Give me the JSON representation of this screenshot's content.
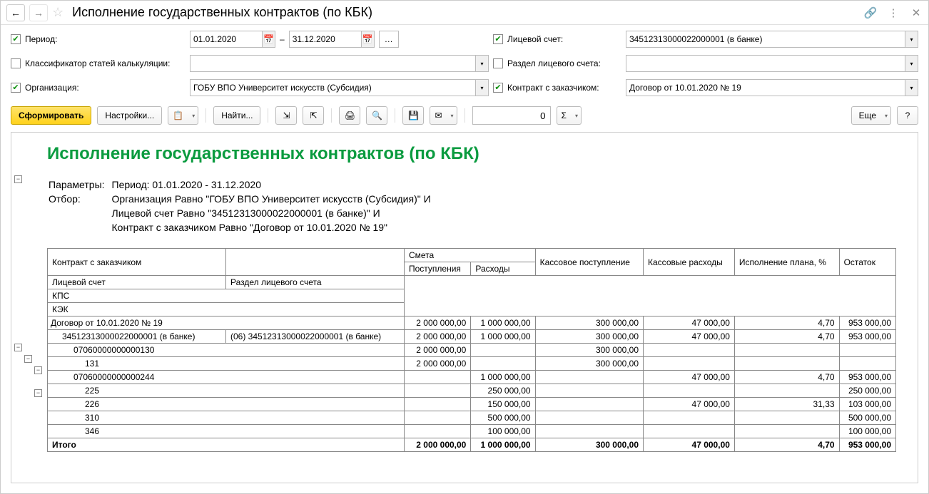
{
  "title": "Исполнение государственных контрактов (по КБК)",
  "filters": {
    "period_label": "Период:",
    "period_from": "01.01.2020",
    "period_to": "31.12.2020",
    "dash": "–",
    "account_label": "Лицевой счет:",
    "account_value": "34512313000022000001 (в банке)",
    "classifier_label": "Классификатор статей калькуляции:",
    "classifier_value": "",
    "section_label": "Раздел лицевого счета:",
    "section_value": "",
    "org_label": "Организация:",
    "org_value": "ГОБУ ВПО Университет искусств (Субсидия)",
    "contract_label": "Контракт с заказчиком:",
    "contract_value": "Договор от 10.01.2020 № 19"
  },
  "toolbar": {
    "generate": "Сформировать",
    "settings": "Настройки...",
    "find": "Найти...",
    "zero": "0",
    "more": "Еще",
    "help": "?"
  },
  "report": {
    "title": "Исполнение государственных контрактов (по КБК)",
    "params_label": "Параметры:",
    "params_text": "Период: 01.01.2020 - 31.12.2020",
    "filter_label": "Отбор:",
    "filter_line1": "Организация Равно \"ГОБУ ВПО Университет искусств (Субсидия)\" И",
    "filter_line2": "Лицевой счет Равно \"34512313000022000001 (в банке)\" И",
    "filter_line3": "Контракт с заказчиком Равно \"Договор от 10.01.2020 № 19\"",
    "headers": {
      "contract": "Контракт с заказчиком",
      "account": "Лицевой счет",
      "section": "Раздел лицевого счета",
      "kps": "КПС",
      "kek": "КЭК",
      "estimate": "Смета",
      "receipts": "Поступления",
      "expenses": "Расходы",
      "cash_in": "Кассовое поступление",
      "cash_out": "Кассовые расходы",
      "plan_pct": "Исполнение плана, %",
      "balance": "Остаток"
    },
    "rows": [
      {
        "c0": "Договор от 10.01.2020 № 19",
        "c1": "",
        "r": "2 000 000,00",
        "e": "1 000 000,00",
        "ci": "300 000,00",
        "co": "47 000,00",
        "p": "4,70",
        "b": "953 000,00",
        "indent": 0
      },
      {
        "c0": "34512313000022000001 (в банке)",
        "c1": "(06) 34512313000022000001 (в банке)",
        "r": "2 000 000,00",
        "e": "1 000 000,00",
        "ci": "300 000,00",
        "co": "47 000,00",
        "p": "4,70",
        "b": "953 000,00",
        "indent": 1
      },
      {
        "c0": "07060000000000130",
        "c1": "",
        "r": "2 000 000,00",
        "e": "",
        "ci": "300 000,00",
        "co": "",
        "p": "",
        "b": "",
        "indent": 2
      },
      {
        "c0": "131",
        "c1": "",
        "r": "2 000 000,00",
        "e": "",
        "ci": "300 000,00",
        "co": "",
        "p": "",
        "b": "",
        "indent": 3
      },
      {
        "c0": "07060000000000244",
        "c1": "",
        "r": "",
        "e": "1 000 000,00",
        "ci": "",
        "co": "47 000,00",
        "p": "4,70",
        "b": "953 000,00",
        "indent": 2
      },
      {
        "c0": "225",
        "c1": "",
        "r": "",
        "e": "250 000,00",
        "ci": "",
        "co": "",
        "p": "",
        "b": "250 000,00",
        "indent": 3
      },
      {
        "c0": "226",
        "c1": "",
        "r": "",
        "e": "150 000,00",
        "ci": "",
        "co": "47 000,00",
        "p": "31,33",
        "b": "103 000,00",
        "indent": 3
      },
      {
        "c0": "310",
        "c1": "",
        "r": "",
        "e": "500 000,00",
        "ci": "",
        "co": "",
        "p": "",
        "b": "500 000,00",
        "indent": 3
      },
      {
        "c0": "346",
        "c1": "",
        "r": "",
        "e": "100 000,00",
        "ci": "",
        "co": "",
        "p": "",
        "b": "100 000,00",
        "indent": 3
      }
    ],
    "total": {
      "label": "Итого",
      "r": "2 000 000,00",
      "e": "1 000 000,00",
      "ci": "300 000,00",
      "co": "47 000,00",
      "p": "4,70",
      "b": "953 000,00"
    }
  },
  "chart_data": {
    "type": "table",
    "title": "Исполнение государственных контрактов (по КБК)",
    "columns": [
      "Контракт с заказчиком",
      "Лицевой счет / Раздел",
      "Поступления",
      "Расходы",
      "Кассовое поступление",
      "Кассовые расходы",
      "Исполнение плана, %",
      "Остаток"
    ],
    "rows": [
      [
        "Договор от 10.01.2020 № 19",
        "",
        2000000.0,
        1000000.0,
        300000.0,
        47000.0,
        4.7,
        953000.0
      ],
      [
        "34512313000022000001 (в банке)",
        "(06) 34512313000022000001 (в банке)",
        2000000.0,
        1000000.0,
        300000.0,
        47000.0,
        4.7,
        953000.0
      ],
      [
        "07060000000000130",
        "",
        2000000.0,
        null,
        300000.0,
        null,
        null,
        null
      ],
      [
        "131",
        "",
        2000000.0,
        null,
        300000.0,
        null,
        null,
        null
      ],
      [
        "07060000000000244",
        "",
        null,
        1000000.0,
        null,
        47000.0,
        4.7,
        953000.0
      ],
      [
        "225",
        "",
        null,
        250000.0,
        null,
        null,
        null,
        250000.0
      ],
      [
        "226",
        "",
        null,
        150000.0,
        null,
        47000.0,
        31.33,
        103000.0
      ],
      [
        "310",
        "",
        null,
        500000.0,
        null,
        null,
        null,
        500000.0
      ],
      [
        "346",
        "",
        null,
        100000.0,
        null,
        null,
        null,
        100000.0
      ],
      [
        "Итого",
        "",
        2000000.0,
        1000000.0,
        300000.0,
        47000.0,
        4.7,
        953000.0
      ]
    ]
  }
}
